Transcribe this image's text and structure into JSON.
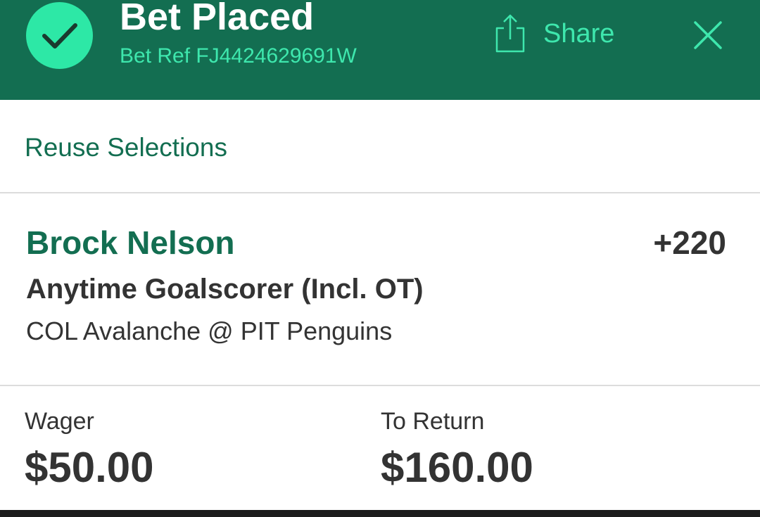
{
  "header": {
    "title": "Bet Placed",
    "bet_ref": "Bet Ref FJ4424629691W",
    "share_label": "Share",
    "status_icon": "checkmark-icon",
    "share_icon": "share-icon",
    "close_icon": "close-icon"
  },
  "reuse": {
    "label": "Reuse Selections"
  },
  "selection": {
    "player": "Brock Nelson",
    "odds": "+220",
    "market": "Anytime Goalscorer (Incl. OT)",
    "event": "COL Avalanche @ PIT Penguins"
  },
  "summary": {
    "wager_label": "Wager",
    "wager_value": "$50.00",
    "return_label": "To Return",
    "return_value": "$160.00"
  },
  "colors": {
    "brand_green": "#136e51",
    "accent_mint": "#3ee7ad",
    "check_circle": "#2de8a6",
    "text_dark": "#333333"
  }
}
